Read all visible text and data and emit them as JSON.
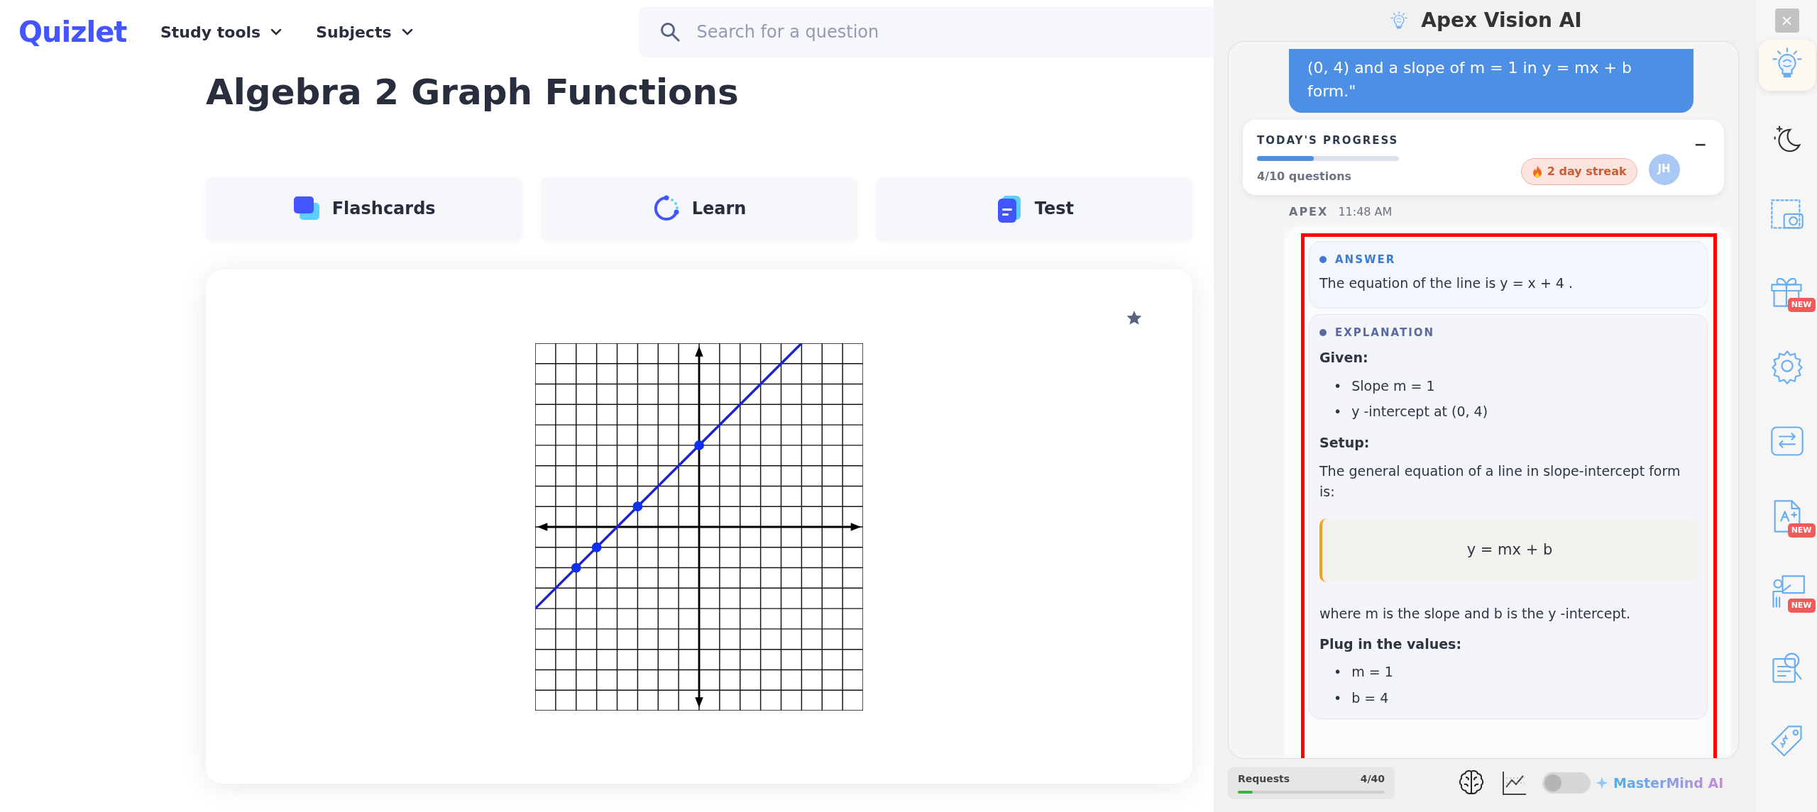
{
  "nav": {
    "logo": "Quizlet",
    "menus": [
      {
        "label": "Study tools"
      },
      {
        "label": "Subjects"
      }
    ],
    "search": {
      "placeholder": "Search for a question"
    }
  },
  "page": {
    "title": "Algebra 2 Graph Functions",
    "modes": [
      {
        "label": "Flashcards",
        "kind": "flashcards"
      },
      {
        "label": "Learn",
        "kind": "learn"
      },
      {
        "label": "Test",
        "kind": "test"
      }
    ]
  },
  "assistant": {
    "title": "Apex Vision AI",
    "user_message": "(0, 4) and a slope of m = 1 in y = mx + b form.\"",
    "progress": {
      "title": "TODAY'S PROGRESS",
      "level": 0.4,
      "caption": "4/10 questions",
      "streak": "2 day streak",
      "avatar": "JH",
      "collapse": "−"
    },
    "reply": {
      "sender": "APEX",
      "time": "11:48 AM",
      "answer": {
        "label": "ANSWER",
        "text": "The equation of the line is  y = x + 4 ."
      },
      "explanation": {
        "label": "EXPLANATION",
        "blocks": [
          {
            "kind": "heading",
            "text": "Given:"
          },
          {
            "kind": "list",
            "marker": "•",
            "items": [
              "Slope  m = 1",
              "y -intercept at  (0, 4)"
            ]
          },
          {
            "kind": "heading",
            "text": "Setup:"
          },
          {
            "kind": "paragraph",
            "text": "The general equation of a line in slope-intercept form is:"
          },
          {
            "kind": "formula",
            "text": "y = mx + b"
          },
          {
            "kind": "paragraph",
            "text": "where  m  is the slope and  b  is the  y -intercept."
          },
          {
            "kind": "heading",
            "text": "Plug in the values:"
          },
          {
            "kind": "list",
            "marker": "•",
            "items": [
              "m = 1",
              "b = 4"
            ]
          }
        ]
      }
    },
    "footer": {
      "requests_label": "Requests",
      "requests_count": "4/40",
      "level": 0.1,
      "mastermind": {
        "label": "MasterMind AI",
        "on": false
      }
    }
  },
  "rail": {
    "close": "×",
    "tools": [
      {
        "kind": "assistant",
        "selected": true
      },
      {
        "kind": "theme",
        "selected": false
      },
      {
        "kind": "screenshot",
        "selected": false
      },
      {
        "kind": "gift",
        "selected": false,
        "badge": "NEW"
      },
      {
        "kind": "settings",
        "selected": false
      },
      {
        "kind": "swap",
        "selected": false
      },
      {
        "kind": "grade",
        "selected": false,
        "badge": "NEW"
      },
      {
        "kind": "teacher",
        "selected": false,
        "badge": "NEW"
      },
      {
        "kind": "review",
        "selected": false
      },
      {
        "kind": "pricing",
        "selected": false
      }
    ]
  }
}
